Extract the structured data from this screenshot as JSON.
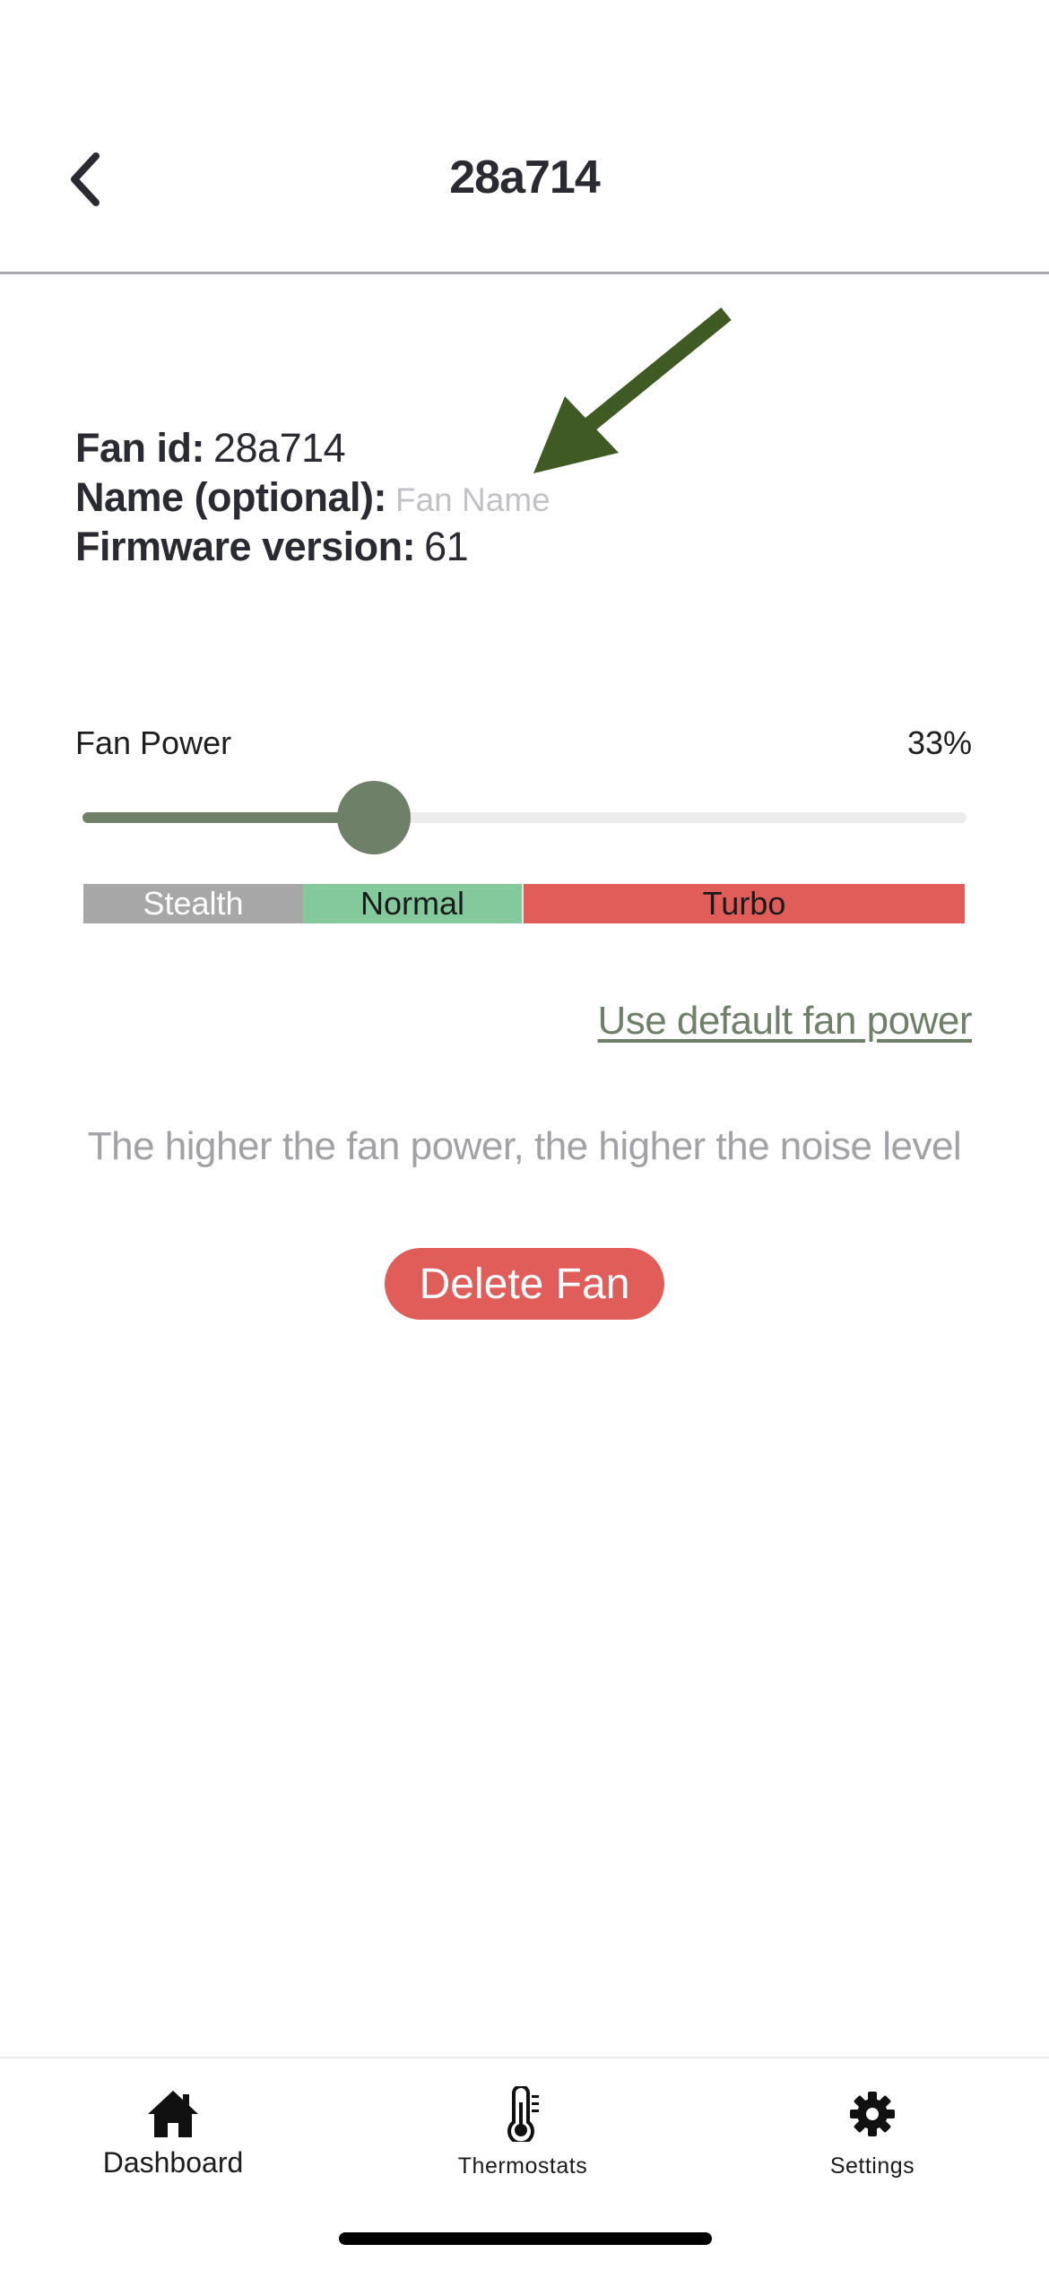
{
  "header": {
    "title": "28a714",
    "back_icon": "chevron-left-icon"
  },
  "info": {
    "fan_id_label": "Fan id:",
    "fan_id_value": "28a714",
    "name_label": "Name (optional):",
    "name_value": "",
    "name_placeholder": "Fan Name",
    "firmware_label": "Firmware version:",
    "firmware_value": "61"
  },
  "annotation": {
    "icon": "arrow-icon",
    "color": "#3f5a23"
  },
  "fan_power": {
    "label": "Fan Power",
    "value_text": "33%",
    "value": 0.33,
    "accent_color": "#6f8068",
    "modes": [
      {
        "label": "Stealth",
        "color": "#a7a7a7"
      },
      {
        "label": "Normal",
        "color": "#84c99b"
      },
      {
        "label": "Turbo",
        "color": "#e05d5a"
      }
    ],
    "default_link": "Use default fan power",
    "hint": "The higher the fan power, the higher the noise level"
  },
  "actions": {
    "delete_label": "Delete Fan",
    "delete_color": "#e05d5a"
  },
  "tabbar": {
    "tabs": [
      {
        "label": "Dashboard",
        "icon": "home-icon"
      },
      {
        "label": "Thermostats",
        "icon": "thermometer-icon"
      },
      {
        "label": "Settings",
        "icon": "gear-icon"
      }
    ]
  }
}
